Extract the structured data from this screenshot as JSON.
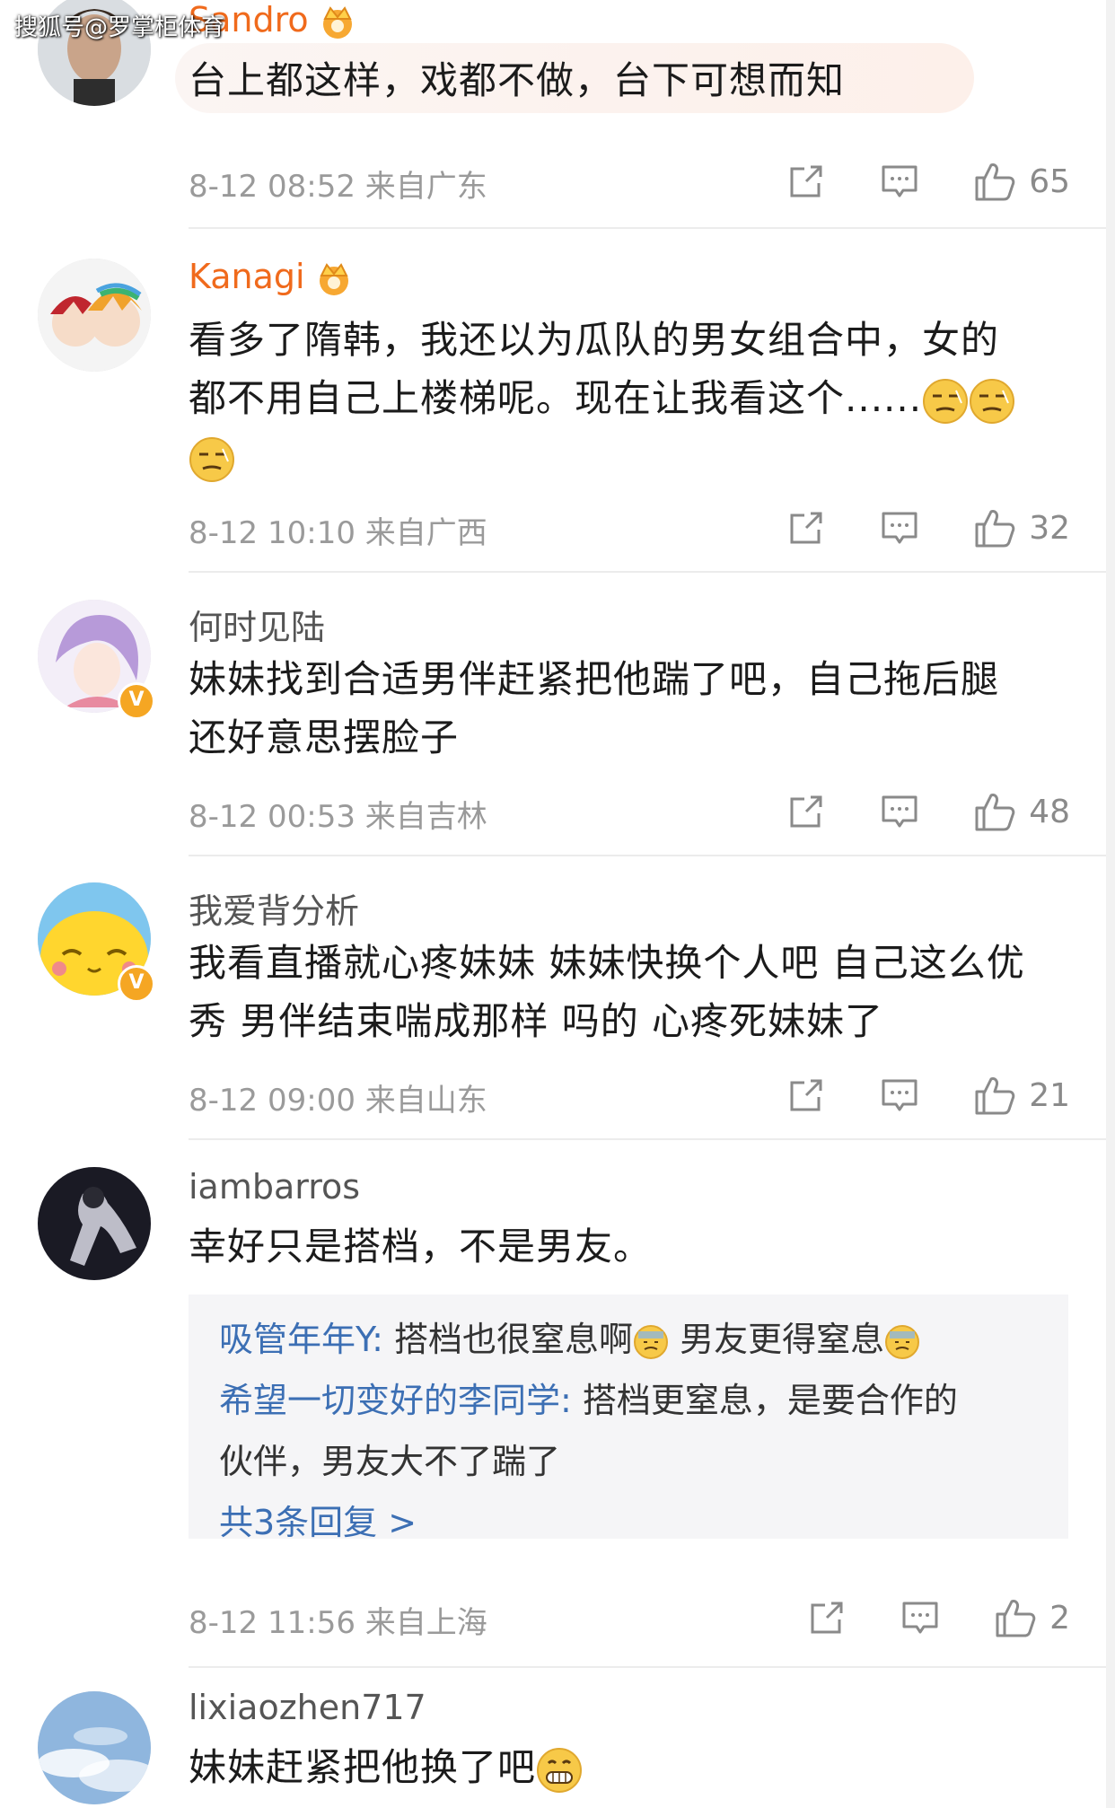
{
  "watermark": "搜狐号@罗掌柜体育",
  "comments": [
    {
      "username": "Sandro",
      "vip": true,
      "text": "台上都这样，戏都不做，台下可想而知",
      "time": "8-12 08:52",
      "location": "来自广东",
      "likes": "65"
    },
    {
      "username": "Kanagi",
      "vip": true,
      "text_line1": "看多了隋韩，我还以为瓜队的男女组合中，女的",
      "text_line2": "都不用自己上楼梯呢。现在让我看这个......",
      "emoji": "smirk-emoji",
      "time": "8-12 10:10",
      "location": "来自广西",
      "likes": "32"
    },
    {
      "username": "何时见陆",
      "verified": true,
      "text_line1": "妹妹找到合适男伴赶紧把他踹了吧，自己拖后腿",
      "text_line2": "还好意思摆脸子",
      "time": "8-12 00:53",
      "location": "来自吉林",
      "likes": "48"
    },
    {
      "username": "我爱背分析",
      "verified": true,
      "text_line1": "我看直播就心疼妹妹 妹妹快换个人吧 自己这么优",
      "text_line2": "秀 男伴结束喘成那样 吗的 心疼死妹妹了",
      "time": "8-12 09:00",
      "location": "来自山东",
      "likes": "21"
    },
    {
      "username": "iambarros",
      "text": "幸好只是搭档，不是男友。",
      "replies": [
        {
          "name": "吸管年年Y:",
          "text_a": " 搭档也很窒息啊",
          "text_b": " 男友更得窒息"
        },
        {
          "name": "希望一切变好的李同学:",
          "text_a": " 搭档更窒息，是要合作的",
          "text_b": "伙伴，男友大不了踹了"
        }
      ],
      "more_replies": "共3条回复 >",
      "time": "8-12 11:56",
      "location": "来自上海",
      "likes": "2"
    },
    {
      "username": "lixiaozhen717",
      "text": "妹妹赶紧把他换了吧",
      "emoji": "grin-emoji"
    }
  ],
  "colors": {
    "vip_name": "#f06a1c",
    "reply_name": "#3c6fb4",
    "meta": "#9a9a9a",
    "verified": "#f5a623"
  }
}
